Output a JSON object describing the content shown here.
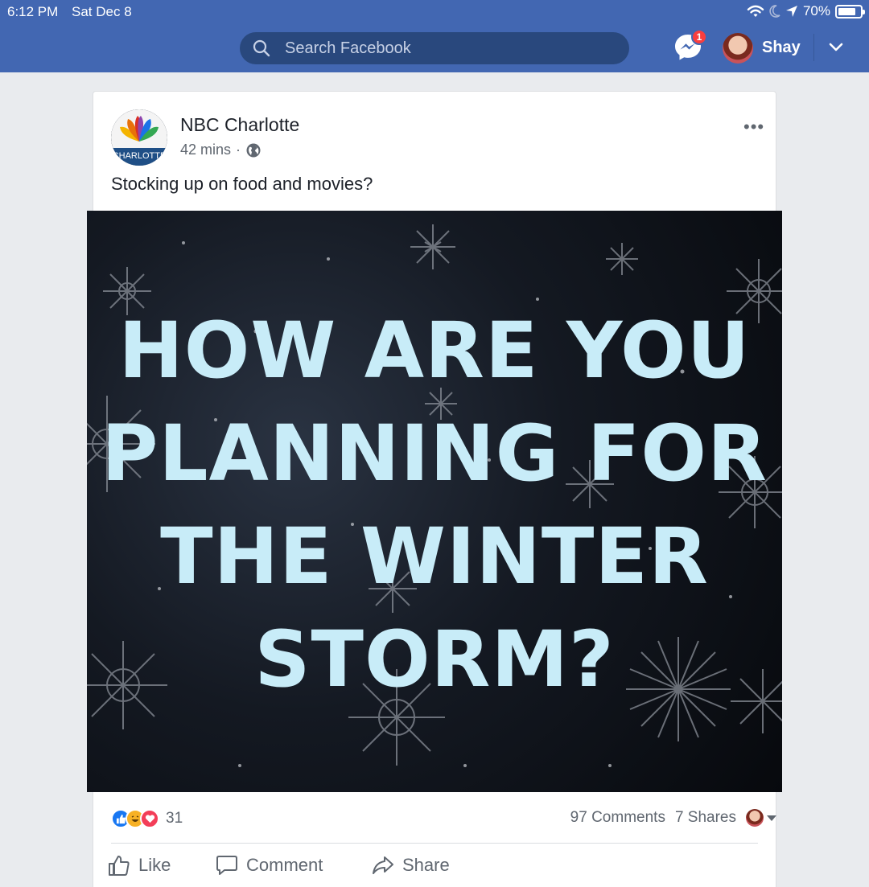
{
  "status_bar": {
    "time": "6:12 PM",
    "date": "Sat Dec 8",
    "battery": "70%"
  },
  "header": {
    "search_placeholder": "Search Facebook",
    "messenger_badge": "1",
    "user_name": "Shay",
    "brand_color": "#4267b2"
  },
  "post": {
    "page_name": "NBC Charlotte",
    "time_ago": "42 mins",
    "privacy_separator": "·",
    "text": "Stocking up on food and movies?",
    "image_headline": [
      "HOW ARE YOU",
      "PLANNING FOR",
      "THE WINTER",
      "STORM?"
    ],
    "logo_text": "CHARLOTTE",
    "reaction_count": "31",
    "comments": "97 Comments",
    "shares": "7 Shares"
  },
  "actions": {
    "like": "Like",
    "comment": "Comment",
    "share": "Share"
  },
  "icons": {
    "search": "search-icon",
    "messenger": "messenger-icon",
    "chevron": "chevron-down-icon",
    "globe": "globe-icon",
    "more": "more-options-icon",
    "like": "thumbs-up-icon",
    "comment": "comment-bubble-icon",
    "share": "share-arrow-icon"
  }
}
